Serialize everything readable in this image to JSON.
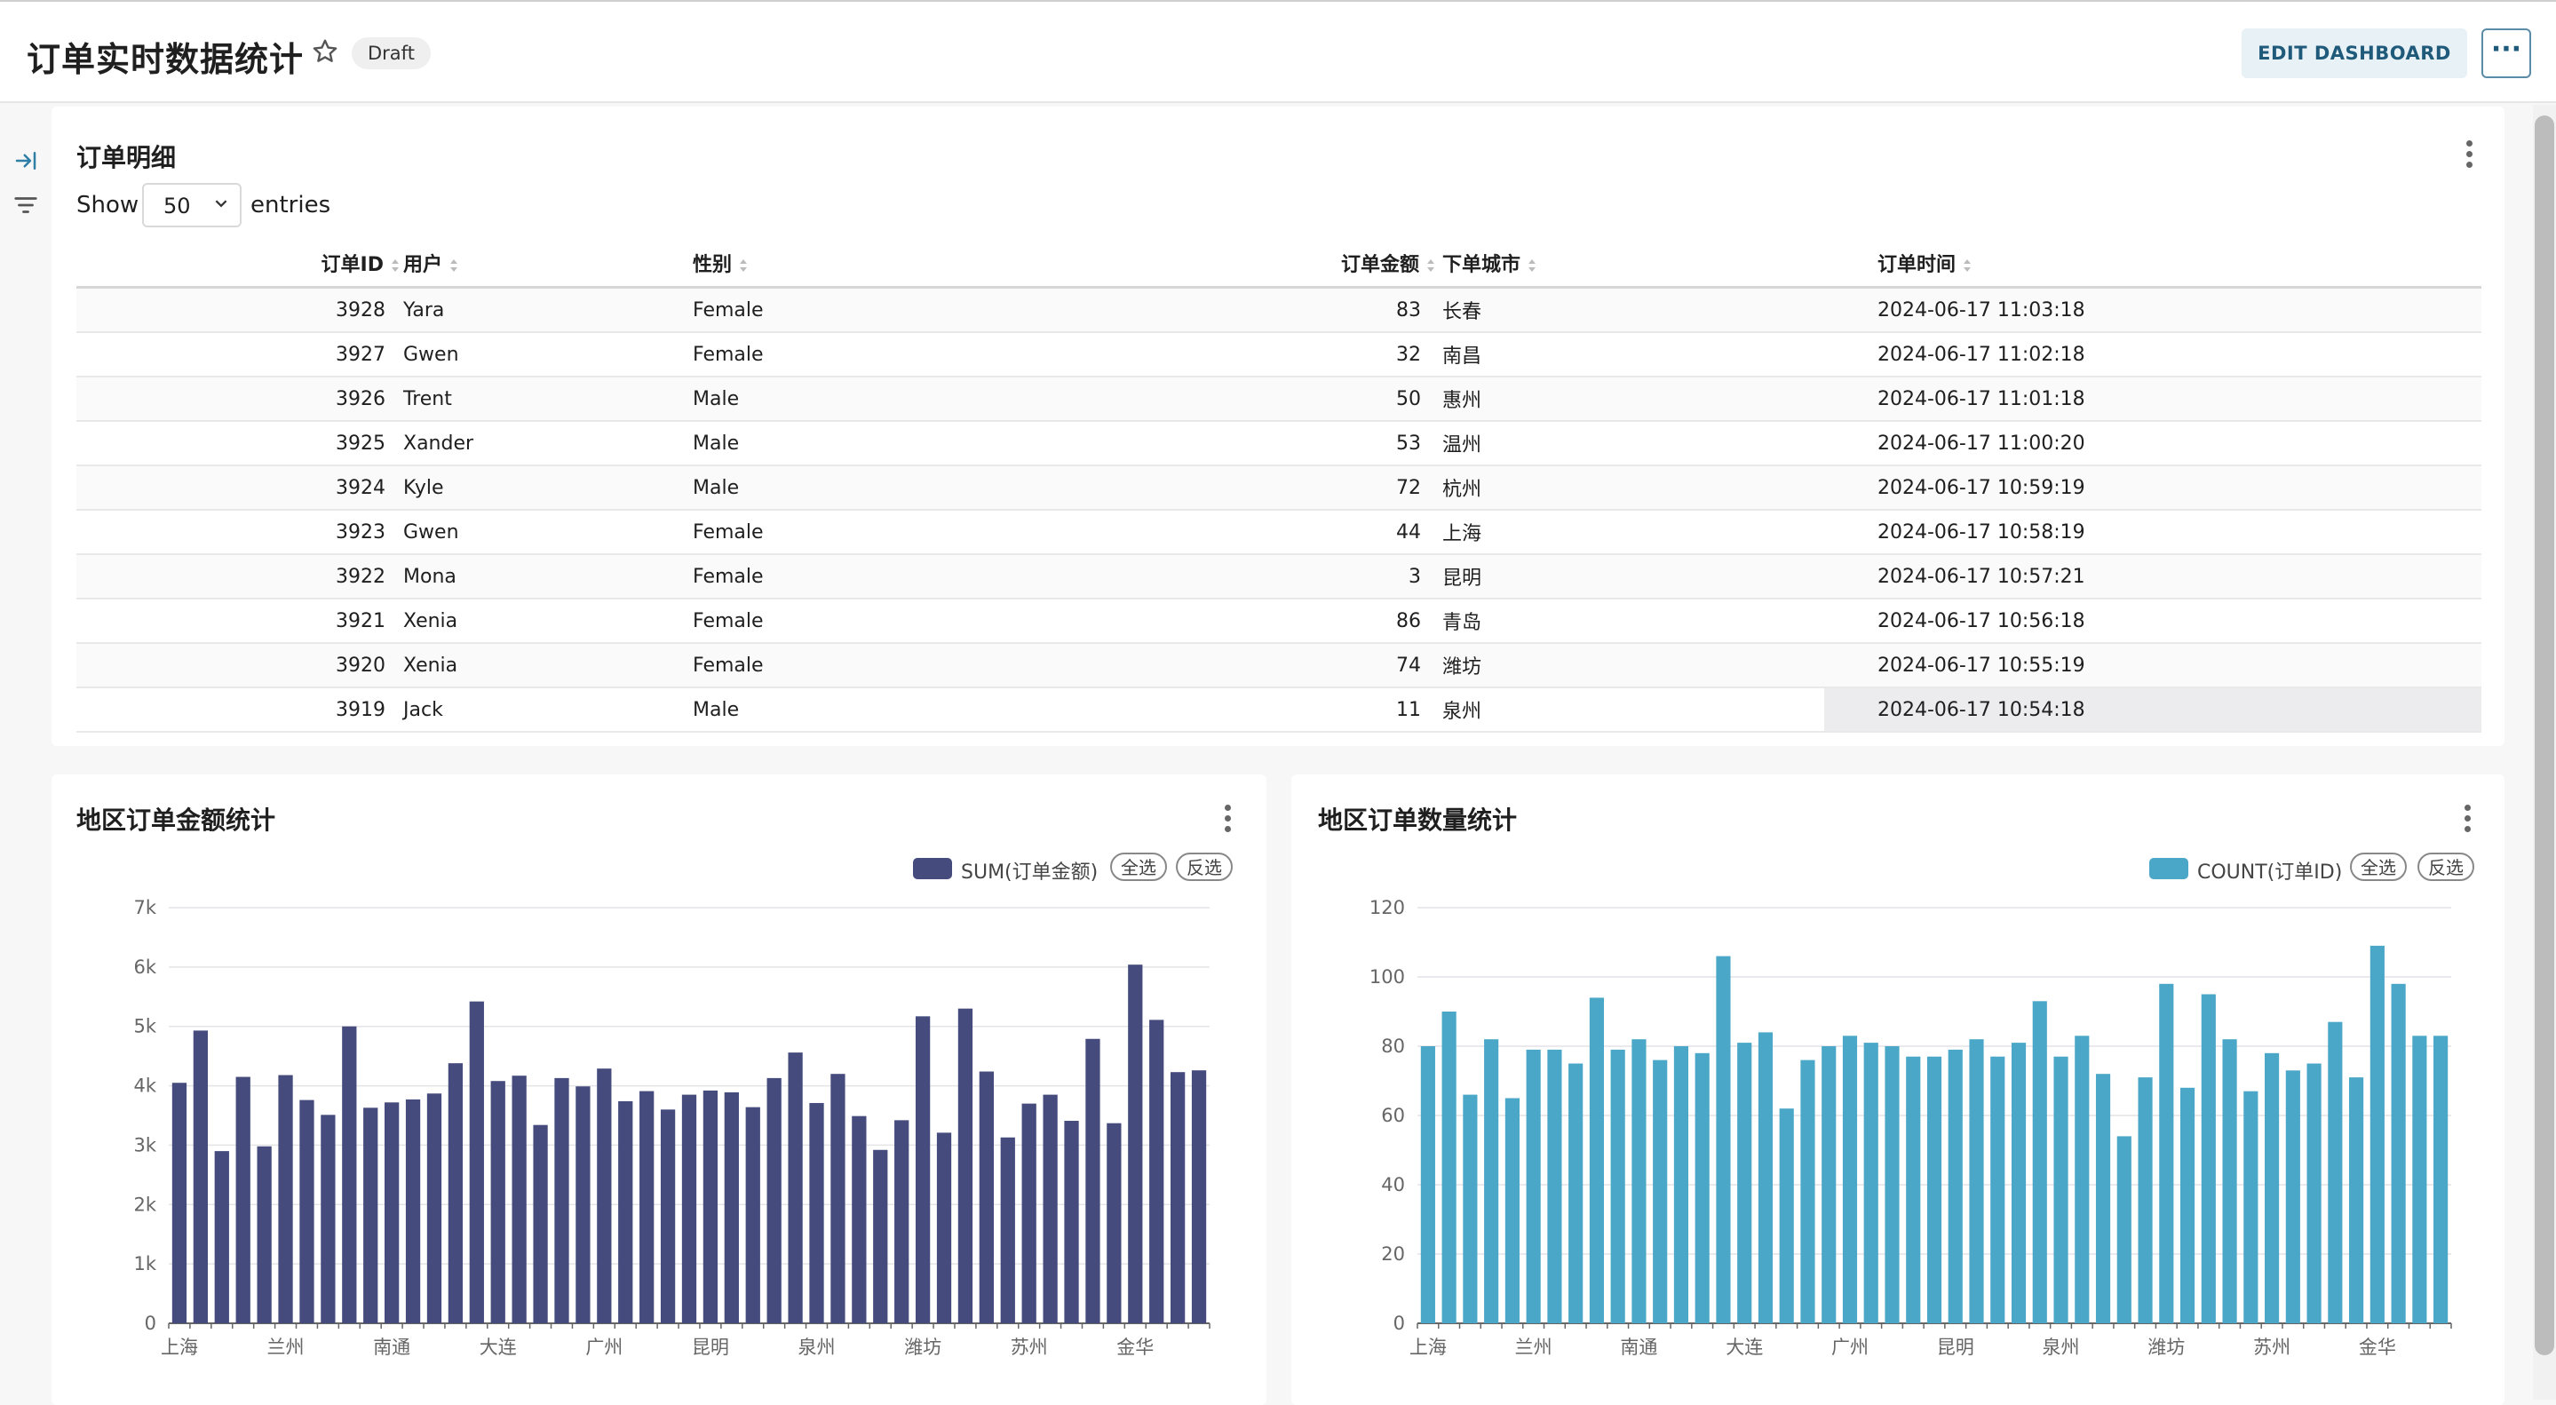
{
  "header": {
    "title": "订单实时数据统计",
    "status_badge": "Draft",
    "edit_button": "EDIT DASHBOARD",
    "more_button": "···"
  },
  "table_panel": {
    "title": "订单明细",
    "show_label": "Show",
    "entries_value": "50",
    "entries_label": "entries",
    "columns": [
      "订单ID",
      "用户",
      "性别",
      "订单金额",
      "下单城市",
      "订单时间"
    ],
    "rows": [
      [
        "3928",
        "Yara",
        "Female",
        "83",
        "长春",
        "2024-06-17 11:03:18"
      ],
      [
        "3927",
        "Gwen",
        "Female",
        "32",
        "南昌",
        "2024-06-17 11:02:18"
      ],
      [
        "3926",
        "Trent",
        "Male",
        "50",
        "惠州",
        "2024-06-17 11:01:18"
      ],
      [
        "3925",
        "Xander",
        "Male",
        "53",
        "温州",
        "2024-06-17 11:00:20"
      ],
      [
        "3924",
        "Kyle",
        "Male",
        "72",
        "杭州",
        "2024-06-17 10:59:19"
      ],
      [
        "3923",
        "Gwen",
        "Female",
        "44",
        "上海",
        "2024-06-17 10:58:19"
      ],
      [
        "3922",
        "Mona",
        "Female",
        "3",
        "昆明",
        "2024-06-17 10:57:21"
      ],
      [
        "3921",
        "Xenia",
        "Female",
        "86",
        "青岛",
        "2024-06-17 10:56:18"
      ],
      [
        "3920",
        "Xenia",
        "Female",
        "74",
        "潍坊",
        "2024-06-17 10:55:19"
      ],
      [
        "3919",
        "Jack",
        "Male",
        "11",
        "泉州",
        "2024-06-17 10:54:18"
      ]
    ]
  },
  "chart_data": [
    {
      "type": "bar",
      "title": "地区订单金额统计",
      "legend": "SUM(订单金额)",
      "legend_placement": "top-right",
      "select_all": "全选",
      "invert_select": "反选",
      "color": "#454b7c",
      "ylim": [
        0,
        7000
      ],
      "yticks": [
        "0",
        "1k",
        "2k",
        "3k",
        "4k",
        "5k",
        "6k",
        "7k"
      ],
      "ytick_values": [
        0,
        1000,
        2000,
        3000,
        4000,
        5000,
        6000,
        7000
      ],
      "xlabels": [
        {
          "index": 0,
          "label": "上海"
        },
        {
          "index": 5,
          "label": "兰州"
        },
        {
          "index": 10,
          "label": "南通"
        },
        {
          "index": 15,
          "label": "大连"
        },
        {
          "index": 20,
          "label": "广州"
        },
        {
          "index": 25,
          "label": "昆明"
        },
        {
          "index": 30,
          "label": "泉州"
        },
        {
          "index": 35,
          "label": "潍坊"
        },
        {
          "index": 40,
          "label": "苏州"
        },
        {
          "index": 45,
          "label": "金华"
        }
      ],
      "values": [
        4050,
        4930,
        2900,
        4150,
        2980,
        4180,
        3760,
        3510,
        5000,
        3630,
        3720,
        3770,
        3870,
        4380,
        5420,
        4080,
        4170,
        3340,
        4130,
        3990,
        4290,
        3740,
        3910,
        3600,
        3850,
        3920,
        3890,
        3640,
        4130,
        4560,
        3710,
        4200,
        3490,
        2920,
        3420,
        5170,
        3210,
        5300,
        4240,
        3130,
        3700,
        3850,
        3410,
        4790,
        3370,
        6040,
        5110,
        4230,
        4260
      ],
      "grid": true
    },
    {
      "type": "bar",
      "title": "地区订单数量统计",
      "legend": "COUNT(订单ID)",
      "legend_placement": "top-right",
      "select_all": "全选",
      "invert_select": "反选",
      "color": "#4ba7c7",
      "ylim": [
        0,
        120
      ],
      "yticks": [
        "0",
        "20",
        "40",
        "60",
        "80",
        "100",
        "120"
      ],
      "ytick_values": [
        0,
        20,
        40,
        60,
        80,
        100,
        120
      ],
      "xlabels": [
        {
          "index": 0,
          "label": "上海"
        },
        {
          "index": 5,
          "label": "兰州"
        },
        {
          "index": 10,
          "label": "南通"
        },
        {
          "index": 15,
          "label": "大连"
        },
        {
          "index": 20,
          "label": "广州"
        },
        {
          "index": 25,
          "label": "昆明"
        },
        {
          "index": 30,
          "label": "泉州"
        },
        {
          "index": 35,
          "label": "潍坊"
        },
        {
          "index": 40,
          "label": "苏州"
        },
        {
          "index": 45,
          "label": "金华"
        }
      ],
      "values": [
        80,
        90,
        66,
        82,
        65,
        79,
        79,
        75,
        94,
        79,
        82,
        76,
        80,
        78,
        106,
        81,
        84,
        62,
        76,
        80,
        83,
        81,
        80,
        77,
        77,
        79,
        82,
        77,
        81,
        93,
        77,
        83,
        72,
        54,
        71,
        98,
        68,
        95,
        82,
        67,
        78,
        73,
        75,
        87,
        71,
        109,
        98,
        83,
        83
      ],
      "grid": true
    }
  ]
}
